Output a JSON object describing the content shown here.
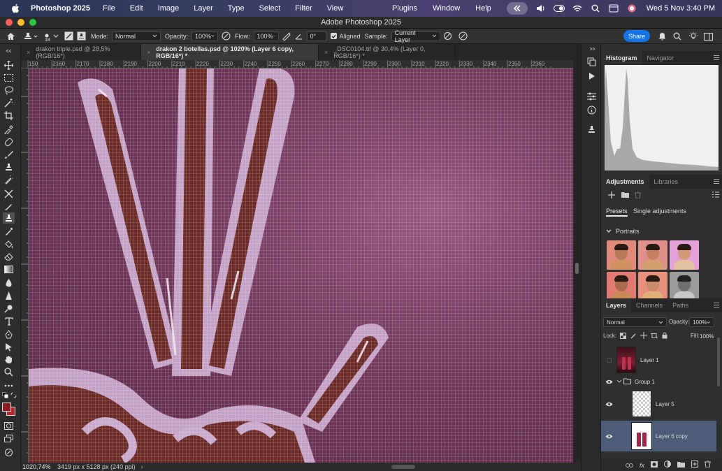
{
  "menubar": {
    "app_name": "Photoshop 2025",
    "items": [
      "File",
      "Edit",
      "Image",
      "Layer",
      "Type",
      "Select",
      "Filter",
      "View"
    ],
    "right_items": [
      "Plugins",
      "Window",
      "Help"
    ],
    "clock": "Wed 5 Nov  3:40 PM"
  },
  "window": {
    "title": "Adobe Photoshop 2025"
  },
  "options": {
    "brush_size": "18",
    "mode_label": "Mode:",
    "mode_value": "Normal",
    "opacity_label": "Opacity:",
    "opacity_value": "100%",
    "flow_label": "Flow:",
    "flow_value": "100%",
    "angle_value": "0°",
    "aligned_label": "Aligned",
    "sample_label": "Sample:",
    "sample_value": "Current Layer",
    "share_label": "Share"
  },
  "tabs": [
    {
      "label": "drakon triple.psd @ 28,5% (RGB/16*)"
    },
    {
      "label": "drakon 2 botellas.psd @ 1020% (Layer 6 copy, RGB/16*) *"
    },
    {
      "label": "_DSC0104.tif @ 30,4% (Layer 0, RGB/16*) *"
    }
  ],
  "ruler_top": [
    "150",
    "2160",
    "2170",
    "2180",
    "2190",
    "2200",
    "2210",
    "2220",
    "2230",
    "2240",
    "2250",
    "2260",
    "2270",
    "2280",
    "2290",
    "2300",
    "2310",
    "2320",
    "2330",
    "2340",
    "2350",
    "2360"
  ],
  "status": {
    "zoom": "1020,74%",
    "doc_info": "3419 px x 5128 px (240 ppi)"
  },
  "histogram_panel": {
    "tabs": [
      "Histogram",
      "Navigator"
    ]
  },
  "adjustments_panel": {
    "tabs": [
      "Adjustments",
      "Libraries"
    ],
    "subtabs": [
      "Presets",
      "Single adjustments"
    ],
    "section": "Portraits"
  },
  "layers_panel": {
    "tabs": [
      "Layers",
      "Channels",
      "Paths"
    ],
    "blend_mode": "Normal",
    "opacity_label": "Opacity:",
    "opacity_value": "100%",
    "lock_label": "Lock:",
    "fill_label": "Fill:",
    "fill_value": "100%",
    "layers": [
      {
        "name": "Layer 1",
        "visible": false
      },
      {
        "name": "Group 1",
        "visible": true
      },
      {
        "name": "Layer 5",
        "visible": true
      },
      {
        "name": "Layer 6 copy",
        "visible": true,
        "selected": true
      }
    ],
    "footer_fx": "fx"
  },
  "colors": {
    "foreground": "#8c1b22",
    "background": "#b3262e",
    "accent": "#1473e6",
    "selected_layer": "#4d5c78"
  }
}
